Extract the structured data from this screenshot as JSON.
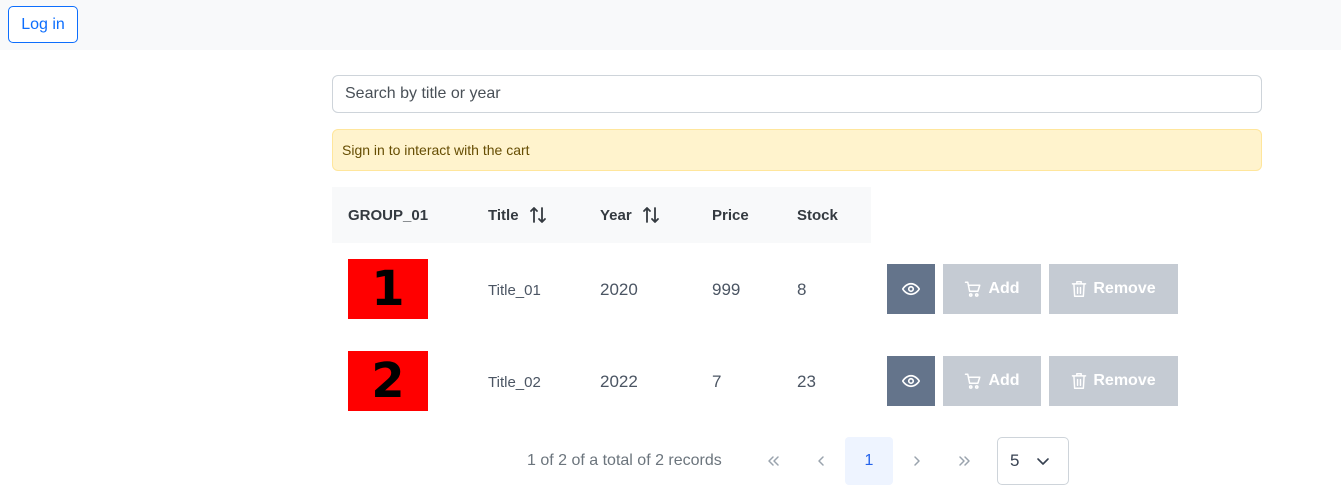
{
  "header": {
    "login_label": "Log in"
  },
  "search": {
    "placeholder": "Search by title or year"
  },
  "alert": {
    "text": "Sign in to interact with the cart"
  },
  "table": {
    "columns": [
      "GROUP_01",
      "Title",
      "Year",
      "Price",
      "Stock"
    ],
    "rows": [
      {
        "image_text": "1",
        "title": "Title_01",
        "year": "2020",
        "price": "999",
        "stock": "8"
      },
      {
        "image_text": "2",
        "title": "Title_02",
        "year": "2022",
        "price": "7",
        "stock": "23"
      }
    ],
    "actions": {
      "add_label": "Add",
      "remove_label": "Remove"
    }
  },
  "pagination": {
    "summary": "1 of 2 of a total of 2 records",
    "first": "«",
    "prev": "‹",
    "current_page": "1",
    "next": "›",
    "last": "»",
    "rows_per_page": "5"
  },
  "icons": {
    "sort": "sort-icon",
    "view": "eye-icon",
    "add": "cart-icon",
    "remove": "trash-icon",
    "dropdown": "chevron-down-icon"
  },
  "colors": {
    "primary": "#0d6efd",
    "alert_bg": "#fff3cd",
    "view_button": "#64748b",
    "disabled_button": "#c5cbd3",
    "thumbnail": "#ff0000"
  }
}
